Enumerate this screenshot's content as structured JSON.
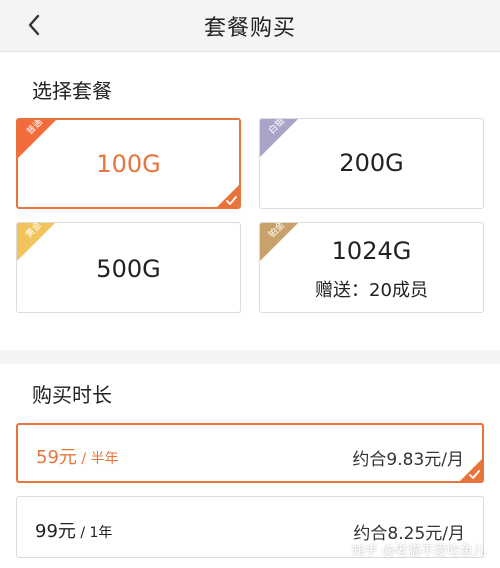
{
  "header": {
    "title": "套餐购买"
  },
  "plans_section": {
    "title": "选择套餐"
  },
  "plans": [
    {
      "badge": "普通",
      "badge_color": "#f26b3a",
      "label": "100G",
      "sub": "",
      "selected": true
    },
    {
      "badge": "白银",
      "badge_color": "#a9a5c9",
      "label": "200G",
      "sub": "",
      "selected": false
    },
    {
      "badge": "黄金",
      "badge_color": "#f1c45c",
      "label": "500G",
      "sub": "",
      "selected": false
    },
    {
      "badge": "铂金",
      "badge_color": "#c8a26a",
      "label": "1024G",
      "sub": "赠送：20成员",
      "selected": false
    }
  ],
  "duration_section": {
    "title": "购买时长"
  },
  "durations": [
    {
      "price": "59元",
      "period": " / 半年",
      "monthly": "约合9.83元/月",
      "selected": true
    },
    {
      "price": "99元",
      "period": " / 1年",
      "monthly": "约合8.25元/月",
      "selected": false
    }
  ],
  "watermark": "知乎 @老猫不爱吃鱼儿",
  "colors": {
    "accent": "#e8743b",
    "border": "#dcdcdc",
    "header_bg": "#f4f4f4"
  },
  "icons": {
    "back": "chevron-left-icon",
    "check": "checkmark-icon"
  }
}
